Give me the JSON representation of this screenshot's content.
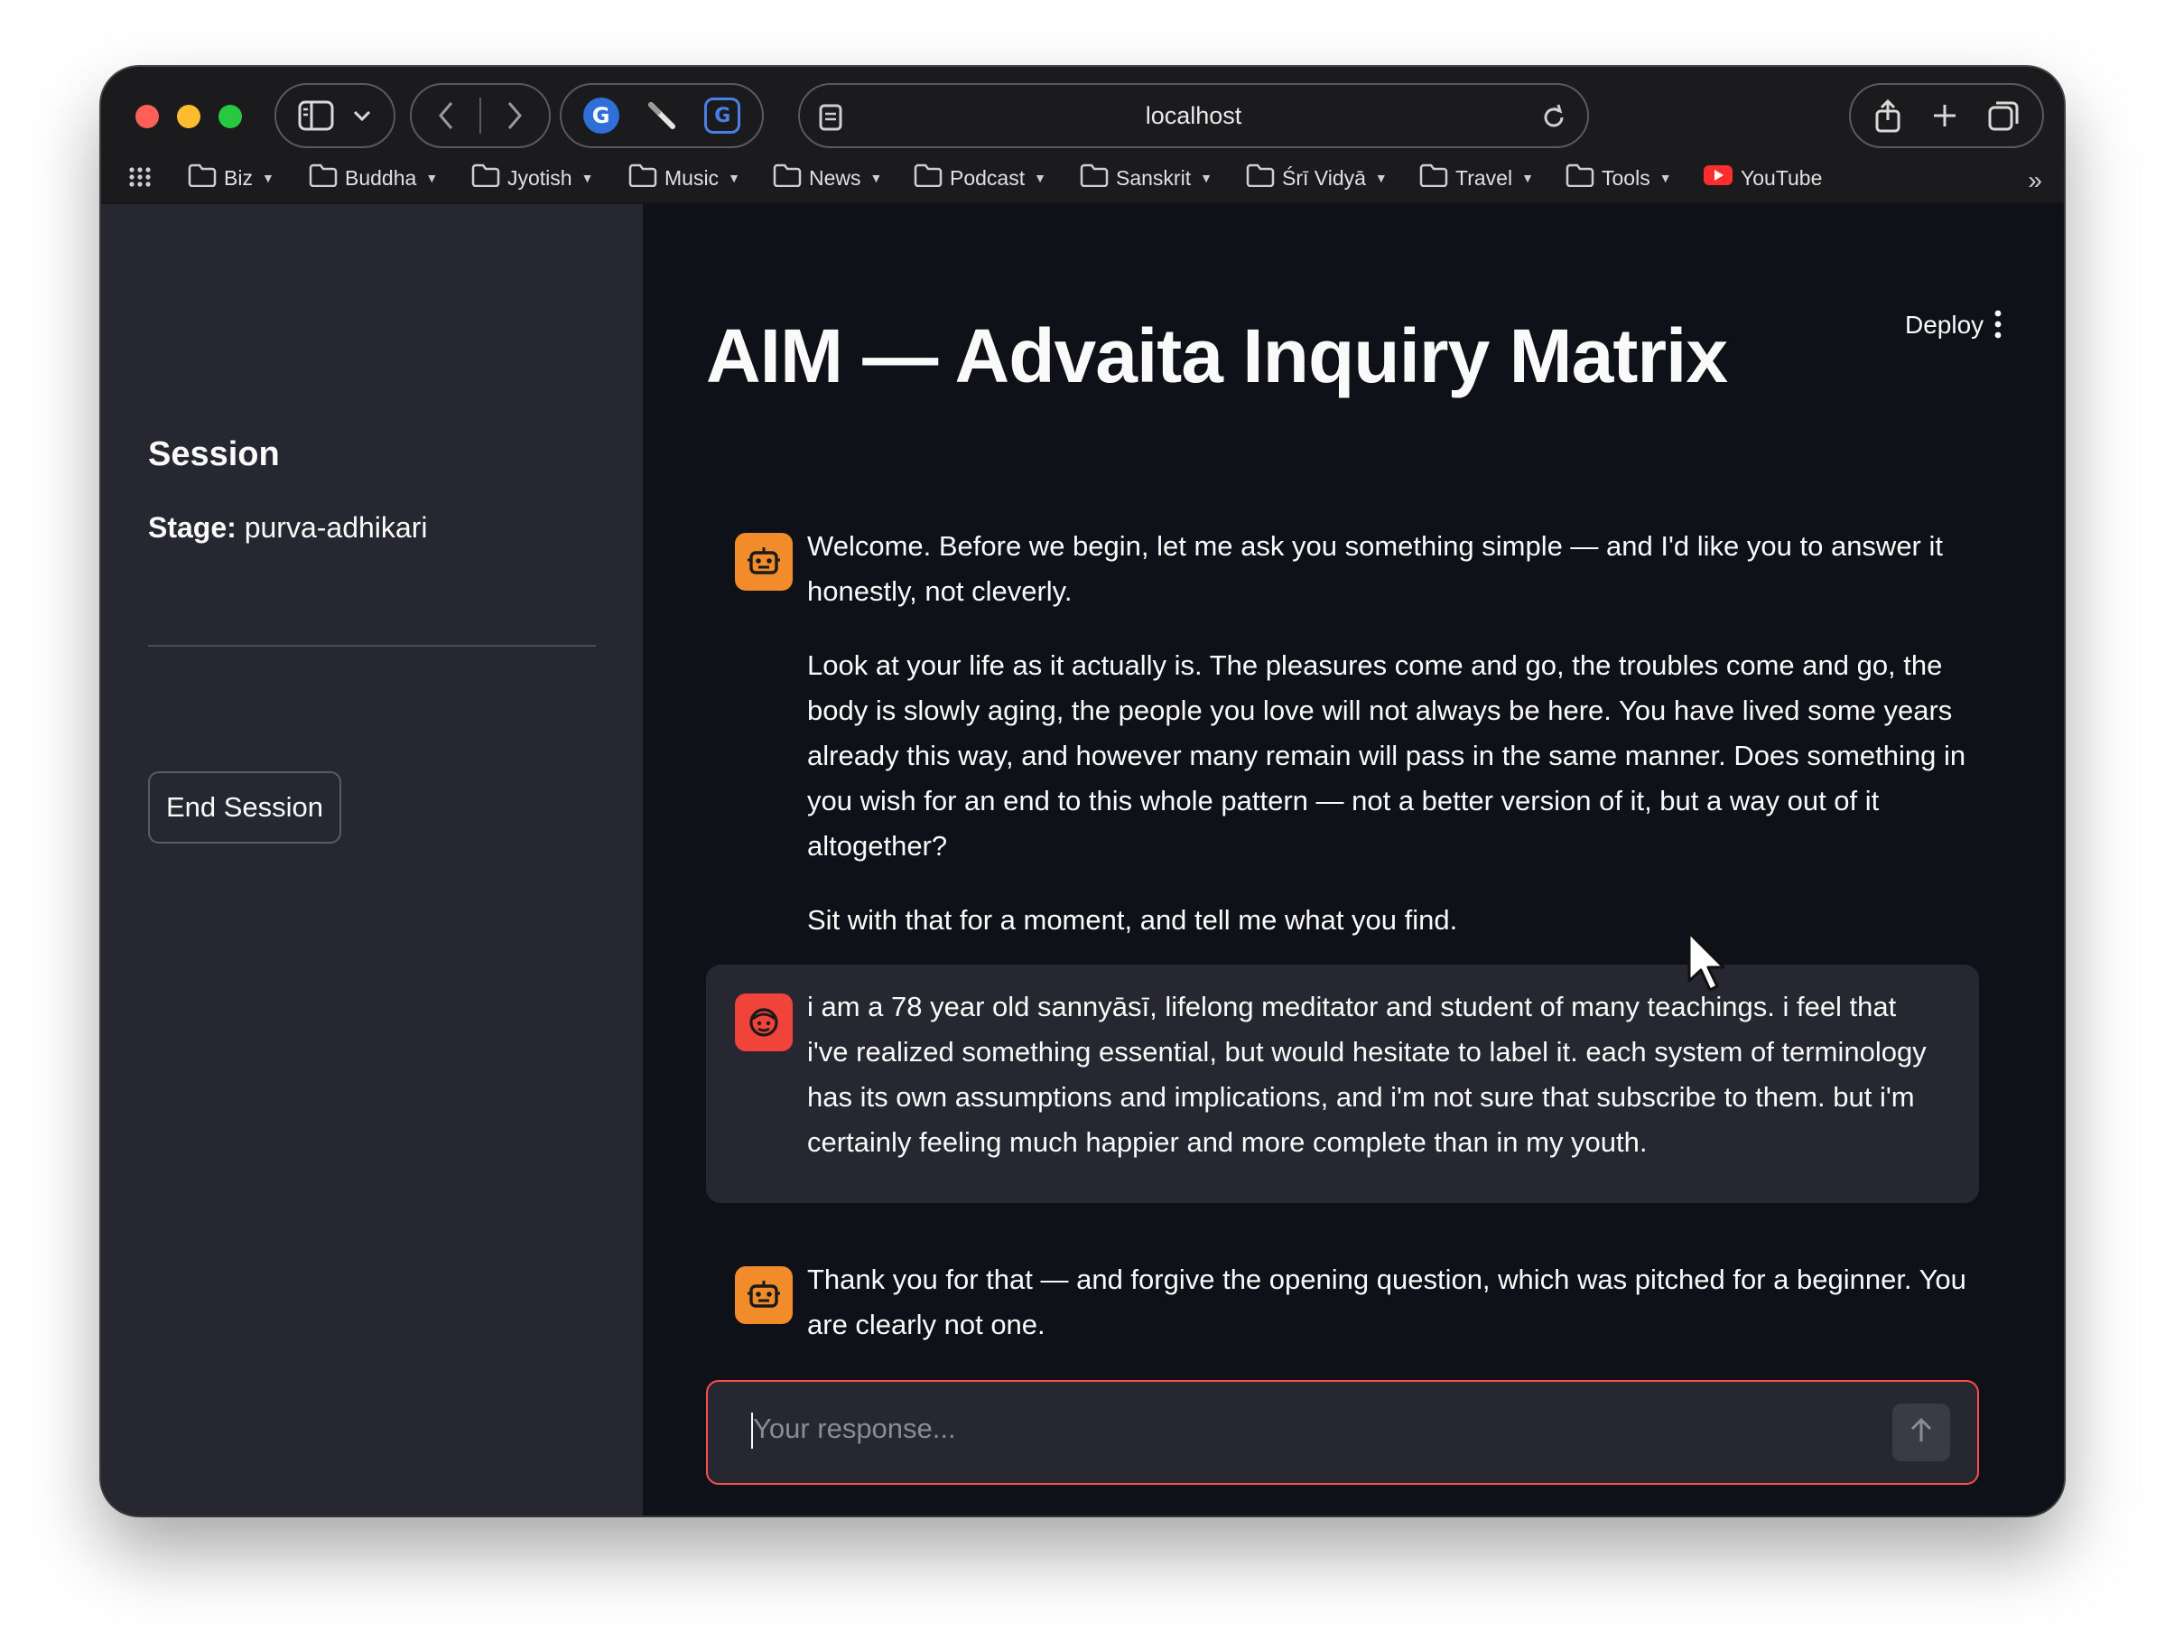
{
  "browser": {
    "address": "localhost",
    "bookmarks": [
      {
        "label": "Biz",
        "type": "folder"
      },
      {
        "label": "Buddha",
        "type": "folder"
      },
      {
        "label": "Jyotish",
        "type": "folder"
      },
      {
        "label": "Music",
        "type": "folder"
      },
      {
        "label": "News",
        "type": "folder"
      },
      {
        "label": "Podcast",
        "type": "folder"
      },
      {
        "label": "Sanskrit",
        "type": "folder"
      },
      {
        "label": "Śrī Vidyā",
        "type": "folder"
      },
      {
        "label": "Travel",
        "type": "folder"
      },
      {
        "label": "Tools",
        "type": "folder"
      },
      {
        "label": "YouTube",
        "type": "link"
      }
    ]
  },
  "sidebar": {
    "title": "Session",
    "stage_label": "Stage:",
    "stage_value": "purva-adhikari",
    "end_button": "End Session"
  },
  "header": {
    "deploy_label": "Deploy"
  },
  "main": {
    "title": "AIM — Advaita Inquiry Matrix",
    "messages": [
      {
        "role": "assistant",
        "paragraphs": [
          "Welcome. Before we begin, let me ask you something simple — and I'd like you to answer it honestly, not cleverly.",
          "Look at your life as it actually is. The pleasures come and go, the troubles come and go, the body is slowly aging, the people you love will not always be here. You have lived some years already this way, and however many remain will pass in the same manner. Does something in you wish for an end to this whole pattern — not a better version of it, but a way out of it altogether?",
          "Sit with that for a moment, and tell me what you find."
        ]
      },
      {
        "role": "user",
        "paragraphs": [
          "i am a 78 year old sannyāsī, lifelong meditator and student of many teachings. i feel that i've realized something essential, but would hesitate to label it. each system of terminology has its own assumptions and implications, and i'm not sure that subscribe to them. but i'm certainly feeling much happier and more complete than in my youth."
        ]
      },
      {
        "role": "assistant",
        "paragraphs": [
          "Thank you for that — and forgive the opening question, which was pitched for a beginner. You are clearly not one."
        ]
      }
    ],
    "input_placeholder": "Your response..."
  },
  "colors": {
    "sidebar_bg": "#262730",
    "main_bg": "#0e1117",
    "assistant_avatar": "#f28b2a",
    "user_avatar": "#f0443a",
    "input_border": "#ff4b4b"
  },
  "icons": {
    "assistant_avatar": "robot-icon",
    "user_avatar": "face-icon",
    "send": "arrow-up-icon"
  }
}
